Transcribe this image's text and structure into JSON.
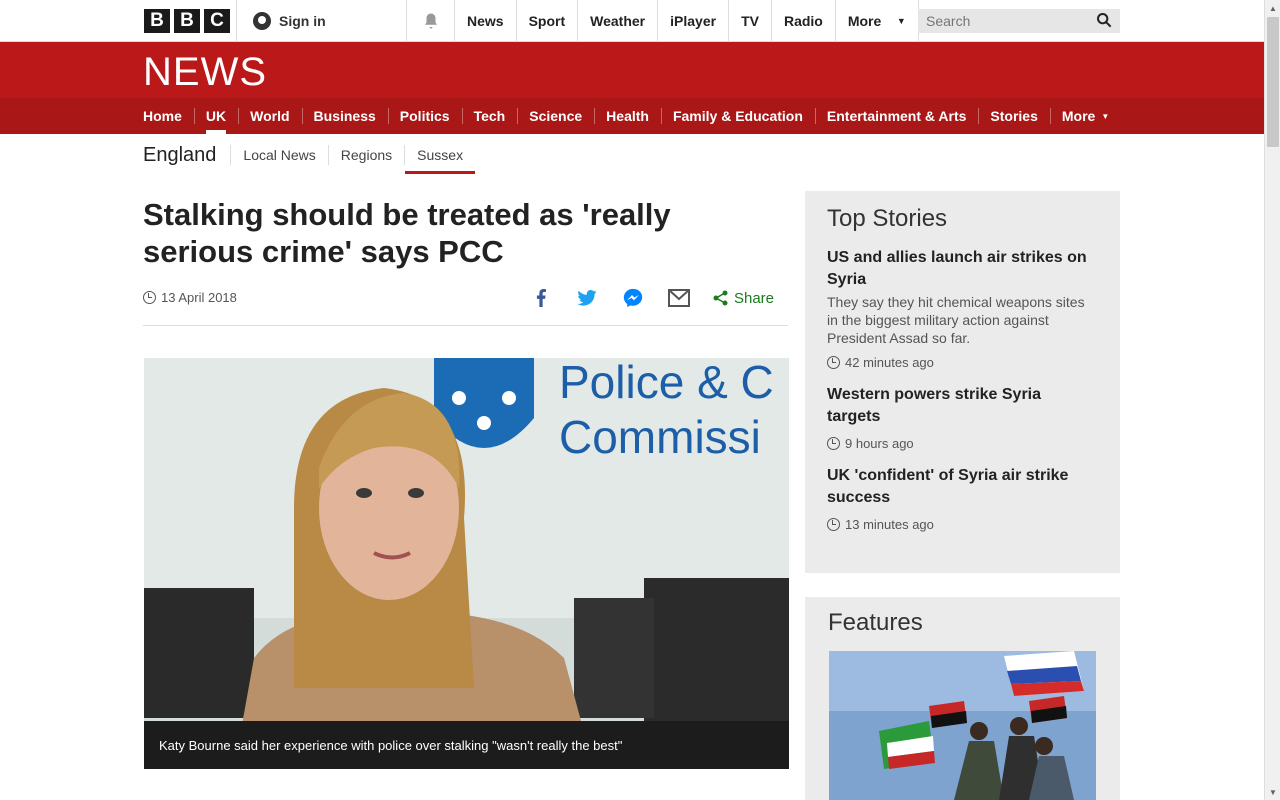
{
  "bbc_logo": [
    "B",
    "B",
    "C"
  ],
  "account": {
    "signin_label": "Sign in"
  },
  "topnav": [
    "News",
    "Sport",
    "Weather",
    "iPlayer",
    "TV",
    "Radio"
  ],
  "topnav_more": "More",
  "search": {
    "placeholder": "Search"
  },
  "masthead": {
    "title": "NEWS"
  },
  "section_nav": [
    "Home",
    "UK",
    "World",
    "Business",
    "Politics",
    "Tech",
    "Science",
    "Health",
    "Family & Education",
    "Entertainment & Arts",
    "Stories"
  ],
  "section_nav_active": "UK",
  "section_nav_more": "More",
  "subnav": {
    "region": "England",
    "items": [
      "Local News",
      "Regions",
      "Sussex"
    ],
    "active": "Sussex"
  },
  "article": {
    "headline": "Stalking should be treated as 'really serious crime' says PCC",
    "date": "13 April 2018",
    "share_label": "Share",
    "image_caption": "Katy Bourne said her experience with police over stalking \"wasn't really the best\"",
    "image_sign_text": [
      "Police & C",
      "Commissi"
    ]
  },
  "top_stories": {
    "title": "Top Stories",
    "items": [
      {
        "title": "US and allies launch air strikes on Syria",
        "summary": "They say they hit chemical weapons sites in the biggest military action against President Assad so far.",
        "time": "42 minutes ago"
      },
      {
        "title": "Western powers strike Syria targets",
        "summary": "",
        "time": "9 hours ago"
      },
      {
        "title": "UK 'confident' of Syria air strike success",
        "summary": "",
        "time": "13 minutes ago"
      }
    ]
  },
  "features": {
    "title": "Features"
  },
  "colors": {
    "brand_red": "#bb1919",
    "nav_red": "#a91717",
    "share_green": "#1d7a1d",
    "facebook": "#3b5998",
    "twitter": "#1da1f2",
    "messenger": "#0084ff"
  }
}
